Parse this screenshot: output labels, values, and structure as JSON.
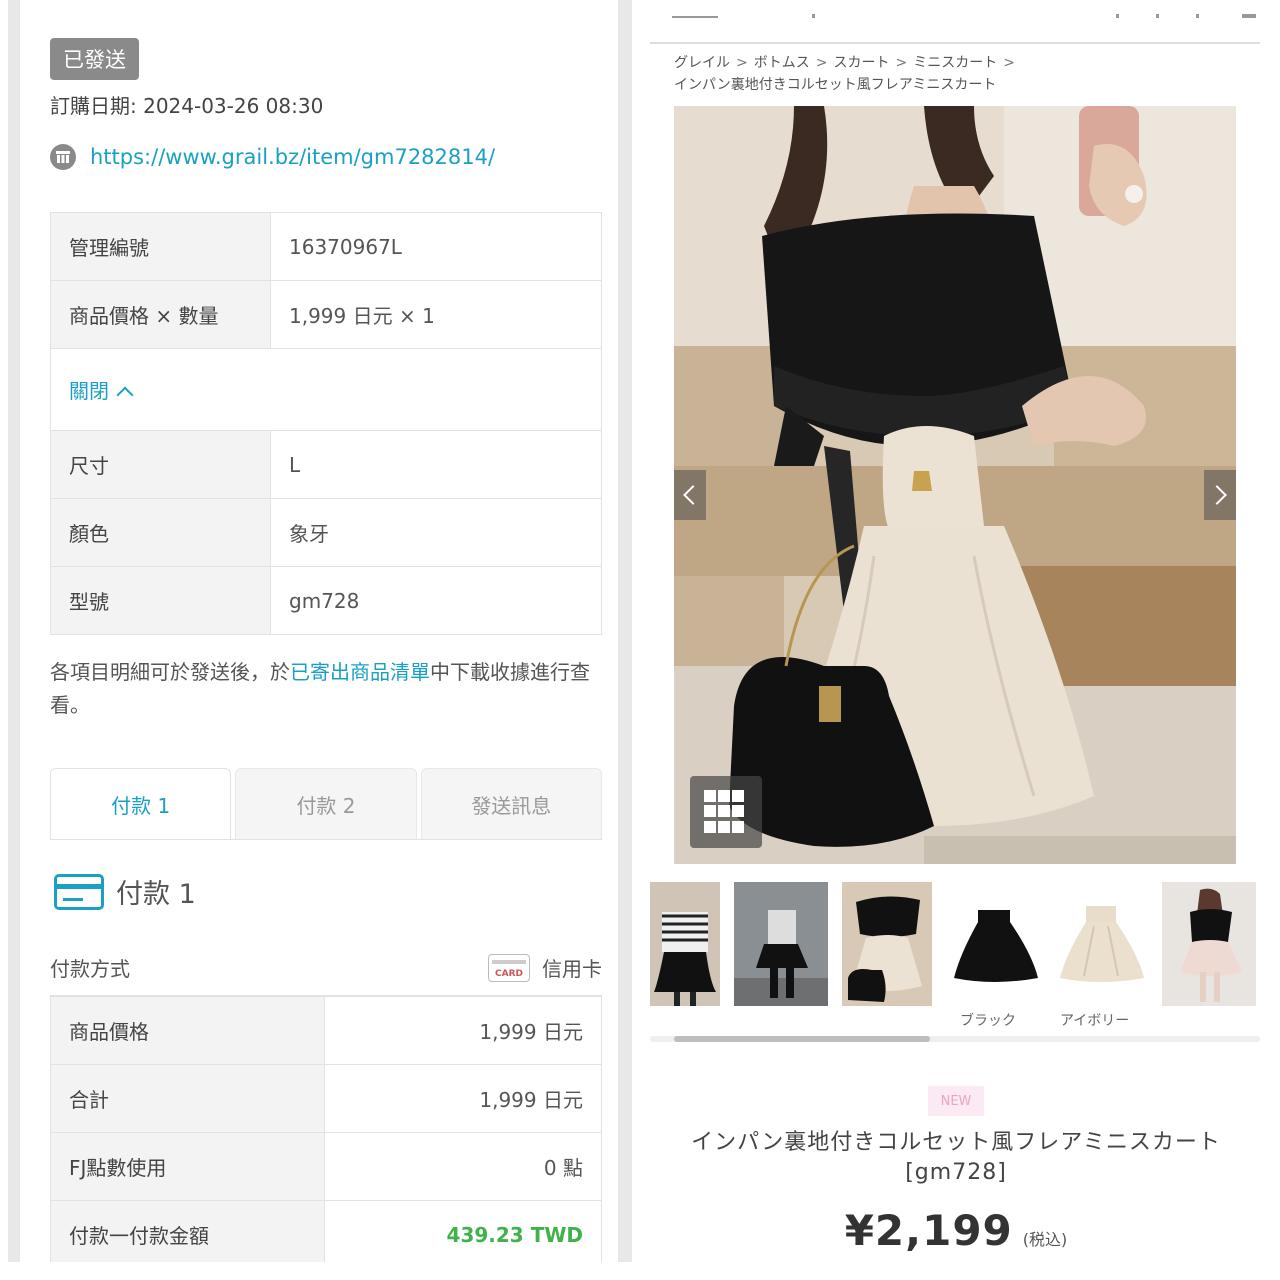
{
  "order": {
    "status": "已發送",
    "order_date": "訂購日期: 2024-03-26 08:30",
    "url": "https://www.grail.bz/item/gm7282814/"
  },
  "info_table": [
    {
      "key": "管理編號",
      "value": "16370967L"
    },
    {
      "key": "商品價格 × 數量",
      "value": "1,999 日元 × 1"
    }
  ],
  "toggle_label": "關閉",
  "options_table": [
    {
      "key": "尺寸",
      "value": "L"
    },
    {
      "key": "顏色",
      "value": "象牙"
    },
    {
      "key": "型號",
      "value": "gm728"
    }
  ],
  "note": {
    "before": "各項目明細可於發送後，於",
    "link": "已寄出商品清單",
    "after": "中下載收據進行查看。"
  },
  "tabs": [
    "付款 1",
    "付款 2",
    "發送訊息"
  ],
  "payment": {
    "title": "付款 1",
    "method_label": "付款方式",
    "method_value": "信用卡",
    "card_badge": "CARD",
    "rows": [
      {
        "key": "商品價格",
        "value": "1,999 日元"
      },
      {
        "key": "合計",
        "value": "1,999 日元"
      },
      {
        "key": "FJ點數使用",
        "value": "0 點"
      },
      {
        "key": "付款一付款金額",
        "value": "439.23 TWD"
      }
    ],
    "amount_color": "#3fb24a"
  },
  "product": {
    "breadcrumb": [
      "グレイル",
      "ボトムス",
      "スカート",
      "ミニスカート"
    ],
    "breadcrumb_current": "インパン裏地付きコルセット風フレアミニスカート",
    "thumb_labels": [
      "ブラック",
      "アイボリー"
    ],
    "new_badge": "NEW",
    "title": "インパン裏地付きコルセット風フレアミニスカート",
    "code": "[gm728]",
    "price": "¥2,199",
    "tax": "(税込)"
  },
  "colors": {
    "accent": "#1aa0c4",
    "status_badge": "#8a8a8a"
  }
}
